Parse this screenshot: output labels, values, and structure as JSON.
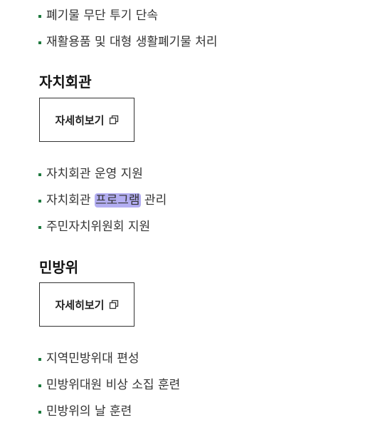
{
  "top_list": {
    "items": [
      {
        "label": "폐기물 무단 투기 단속"
      },
      {
        "label": "재활용품 및 대형 생활폐기물 처리"
      }
    ]
  },
  "hall_section": {
    "title": "자치회관",
    "detail_button": "자세히보기",
    "items": [
      {
        "label": "자치회관 운영 지원"
      },
      {
        "before": "자치회관 ",
        "highlight": "프로그램",
        "after": " 관리"
      },
      {
        "label": "주민자치위원회 지원"
      }
    ]
  },
  "civil_defense_section": {
    "title": "민방위",
    "detail_button": "자세히보기",
    "items": [
      {
        "label": "지역민방위대 편성"
      },
      {
        "label": "민방위대원 비상 소집 훈련"
      },
      {
        "label": "민방위의 날 훈련"
      }
    ]
  },
  "icons": {
    "detail_button_icon": "new-window-icon"
  },
  "colors": {
    "bullet": "#1f7a3f",
    "highlight": "#b3aef2",
    "text": "#333333"
  }
}
